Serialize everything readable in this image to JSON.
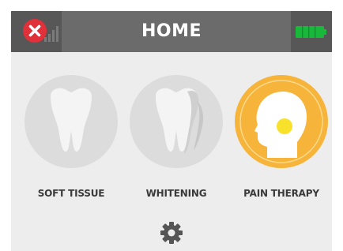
{
  "header": {
    "title": "HOME",
    "close_icon": "close-icon",
    "signal_icon": "signal-strength-icon",
    "battery_icon": "battery-full-icon"
  },
  "modes": [
    {
      "label": "SOFT TISSUE",
      "icon": "tooth-icon",
      "state": "inactive"
    },
    {
      "label": "WHITENING",
      "icon": "tooth-whitening-icon",
      "state": "inactive"
    },
    {
      "label": "PAIN THERAPY",
      "icon": "head-profile-icon",
      "state": "selected"
    }
  ],
  "footer": {
    "settings_icon": "gear-icon"
  },
  "colors": {
    "header_bg": "#6b6b6b",
    "header_side_bg": "#575757",
    "screen_bg": "#ededed",
    "close_red": "#e0303a",
    "battery_green": "#18b83a",
    "inactive_circle": "#dcdcdc",
    "inactive_tooth": "#f4f4f4",
    "selected_circle": "#f6b53a",
    "accent_yellow": "#f8e12b",
    "settings_gray": "#555555"
  }
}
